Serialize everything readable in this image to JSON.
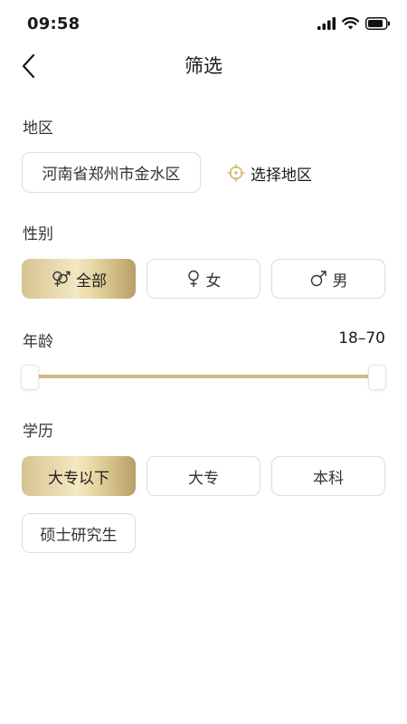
{
  "status_bar": {
    "time": "09:58"
  },
  "nav": {
    "title": "筛选"
  },
  "region": {
    "label": "地区",
    "value": "河南省郑州市金水区",
    "select_label": "选择地区"
  },
  "gender": {
    "label": "性别",
    "options": [
      {
        "label": "全部",
        "icon": "gender-both-icon",
        "selected": true
      },
      {
        "label": "女",
        "icon": "female-icon",
        "selected": false
      },
      {
        "label": "男",
        "icon": "male-icon",
        "selected": false
      }
    ]
  },
  "age": {
    "label": "年龄",
    "range_text": "18–70",
    "min": 18,
    "max": 70
  },
  "education": {
    "label": "学历",
    "options": [
      {
        "label": "大专以下",
        "selected": true
      },
      {
        "label": "大专",
        "selected": false
      },
      {
        "label": "本科",
        "selected": false
      },
      {
        "label": "硕士研究生",
        "selected": false
      }
    ]
  },
  "colors": {
    "accent_gold": "#cdb983",
    "chip_border": "#dcdcdc",
    "text": "#333333"
  }
}
